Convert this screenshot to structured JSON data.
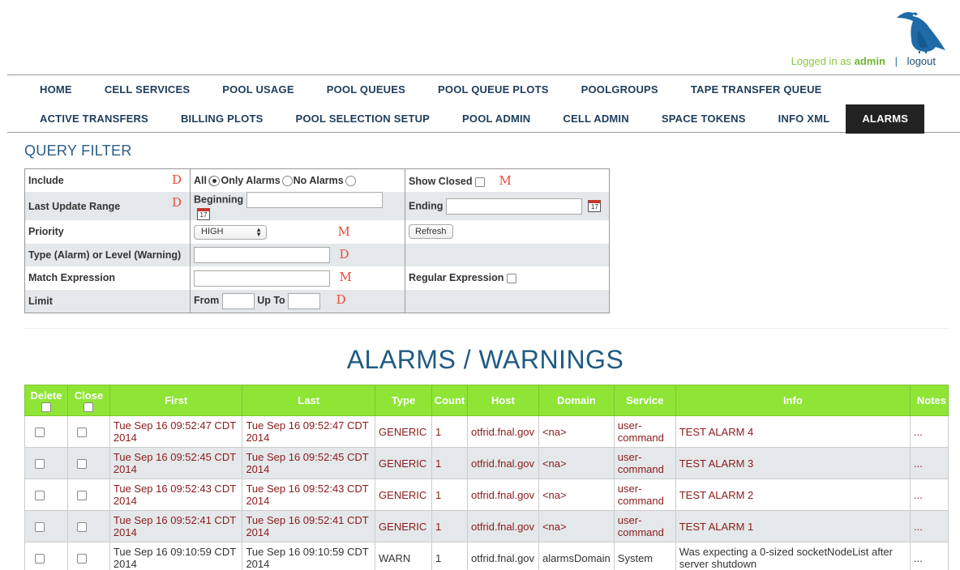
{
  "header": {
    "logged_in_as": "Logged in as",
    "user": "admin",
    "separator": "|",
    "logout": "logout"
  },
  "nav": {
    "row1": [
      "HOME",
      "CELL SERVICES",
      "POOL USAGE",
      "POOL QUEUES",
      "POOL QUEUE PLOTS",
      "POOLGROUPS",
      "TAPE TRANSFER QUEUE"
    ],
    "row2": [
      "ACTIVE TRANSFERS",
      "BILLING PLOTS",
      "POOL SELECTION SETUP",
      "POOL ADMIN",
      "CELL ADMIN",
      "SPACE TOKENS",
      "INFO XML",
      "ALARMS"
    ],
    "active": "ALARMS"
  },
  "query_filter": {
    "title": "QUERY FILTER",
    "include_label": "Include",
    "include_tag": "D",
    "include_all": "All",
    "include_only_alarms": "Only Alarms",
    "include_no_alarms": "No Alarms",
    "show_closed_label": "Show Closed",
    "show_closed_tag": "M",
    "last_update_label": "Last Update Range",
    "last_update_tag": "D",
    "beginning_label": "Beginning",
    "ending_label": "Ending",
    "calendar_day": "17",
    "priority_label": "Priority",
    "priority_value": "HIGH",
    "priority_tag": "M",
    "refresh_label": "Refresh",
    "type_label": "Type (Alarm) or Level (Warning)",
    "type_tag": "D",
    "match_label": "Match Expression",
    "match_tag": "M",
    "regex_label": "Regular Expression",
    "limit_label": "Limit",
    "from_label": "From",
    "upto_label": "Up To",
    "limit_tag": "D"
  },
  "alarms": {
    "title": "ALARMS / WARNINGS",
    "columns": [
      "Delete",
      "Close",
      "First",
      "Last",
      "Type",
      "Count",
      "Host",
      "Domain",
      "Service",
      "Info",
      "Notes"
    ],
    "rows": [
      {
        "first": "Tue Sep 16 09:52:47 CDT 2014",
        "last": "Tue Sep 16 09:52:47 CDT 2014",
        "type": "GENERIC",
        "count": "1",
        "host": "otfrid.fnal.gov",
        "domain": "<na>",
        "service": "user-command",
        "info": "TEST ALARM 4",
        "notes": "..."
      },
      {
        "first": "Tue Sep 16 09:52:45 CDT 2014",
        "last": "Tue Sep 16 09:52:45 CDT 2014",
        "type": "GENERIC",
        "count": "1",
        "host": "otfrid.fnal.gov",
        "domain": "<na>",
        "service": "user-command",
        "info": "TEST ALARM 3",
        "notes": "..."
      },
      {
        "first": "Tue Sep 16 09:52:43 CDT 2014",
        "last": "Tue Sep 16 09:52:43 CDT 2014",
        "type": "GENERIC",
        "count": "1",
        "host": "otfrid.fnal.gov",
        "domain": "<na>",
        "service": "user-command",
        "info": "TEST ALARM 2",
        "notes": "..."
      },
      {
        "first": "Tue Sep 16 09:52:41 CDT 2014",
        "last": "Tue Sep 16 09:52:41 CDT 2014",
        "type": "GENERIC",
        "count": "1",
        "host": "otfrid.fnal.gov",
        "domain": "<na>",
        "service": "user-command",
        "info": "TEST ALARM 1",
        "notes": "..."
      },
      {
        "first": "Tue Sep 16 09:10:59 CDT 2014",
        "last": "Tue Sep 16 09:10:59 CDT 2014",
        "type": "WARN",
        "count": "1",
        "host": "otfrid.fnal.gov",
        "domain": "alarmsDomain",
        "service": "System",
        "info": "Was expecting a 0-sized socketNodeList after server shutdown",
        "notes": "..."
      }
    ]
  },
  "colors": {
    "accent_green": "#8ee536",
    "title_blue": "#1f5b82",
    "alarm_red": "#8b1a1a"
  }
}
